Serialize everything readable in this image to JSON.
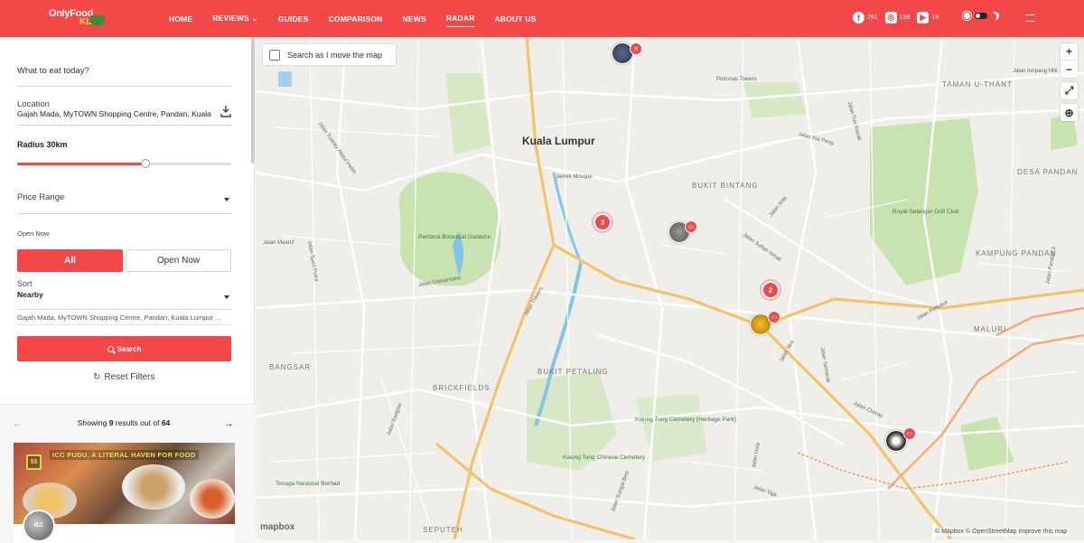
{
  "brand": {
    "logo_line1": "OnlyFood",
    "logo_line2": "KL"
  },
  "nav": [
    {
      "label": "HOME"
    },
    {
      "label": "REVIEWS ⌄"
    },
    {
      "label": "GUIDES"
    },
    {
      "label": "COMPARISON"
    },
    {
      "label": "NEWS"
    },
    {
      "label": "RADAR",
      "active": true
    },
    {
      "label": "ABOUT US"
    }
  ],
  "social": {
    "facebook": {
      "icon": "facebook-icon",
      "count": "261"
    },
    "instagram": {
      "icon": "instagram-icon",
      "count": "198"
    },
    "youtube": {
      "icon": "youtube-icon",
      "count": "19"
    }
  },
  "sidebar": {
    "eat_placeholder": "What to eat today?",
    "location_label": "Location",
    "location_value": "Gajah Mada, MyTOWN Shopping Centre, Pandan, Kuala",
    "radius_label": "Radius 30km",
    "radius_fraction": 0.6,
    "price_label": "Price Range",
    "open_label": "Open Now",
    "btn_all": "All",
    "btn_open": "Open Now",
    "sort_label": "Sort",
    "sort_value": "Nearby",
    "address_full": "Gajah Mada, MyTOWN Shopping Centre, Pandan, Kuala Lumpur ...",
    "search_label": "Search",
    "reset_label": "Reset Filters"
  },
  "results": {
    "prefix": "Showing ",
    "shown": "9",
    "mid": " results out of ",
    "total": "64",
    "card": {
      "banner": "ICC PUDU, A LITERAL HAVEN FOR FOOD",
      "price": "$$",
      "avatar_text": "ICC"
    }
  },
  "map": {
    "search_move_label": "Search as I move the map",
    "zoom_in": "+",
    "zoom_out": "−",
    "city_label": "Kuala Lumpur",
    "areas": [
      "BUKIT BINTANG",
      "TAMAN U-THANT",
      "DESA PANDAN",
      "KAMPUNG PANDAN",
      "MALURI",
      "BANGSAR",
      "BRICKFIELDS",
      "BUKIT PETALING",
      "SEPUTEH"
    ],
    "parks": [
      "Perdana Botanical Gardens",
      "Royal Selangor Golf Club",
      "Kwong Tung Cemetery (Heritage Park)",
      "Kwong Tong Chinese Cemetery",
      "Tenaga Nasional Berhad",
      "Petronas Towers",
      "Jamek Mosque"
    ],
    "roads": [
      "Jalan Ampang Hilir",
      "Jalan Tun Razak",
      "Jalan Kia Peng",
      "Jalan Imbi",
      "Jalan Sultan Ismail",
      "Jalan Perkasa",
      "Jalan Damansara",
      "Jalan Bangsar",
      "Jalan Travers",
      "Jalan Tuanku Abdul Halim",
      "Jalan Maarof",
      "Jalan Syed Putra",
      "Jalan Yew",
      "Jalan Cheras",
      "Jalan Tiga",
      "Jalan Duta",
      "Jalan Pandan 3",
      "Jalan Sungai Besi",
      "Jalan Semarak"
    ],
    "clusters": [
      {
        "count": "3"
      },
      {
        "count": "2"
      }
    ],
    "mapbox": "mapbox",
    "attribution": "© Mapbox © OpenStreetMap Improve this map"
  },
  "colors": {
    "accent": "#f44848",
    "map_bg": "#f0eee8",
    "park": "#c8e2b0",
    "road_major": "#f2c46a",
    "water": "#7fc6e8"
  }
}
